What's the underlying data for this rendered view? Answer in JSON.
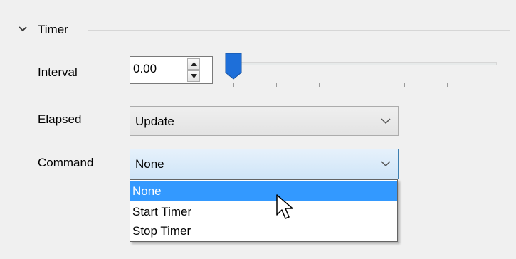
{
  "group": {
    "title": "Timer",
    "expanded": true
  },
  "interval": {
    "label": "Interval",
    "value": "0.00",
    "slider_fraction": 0.0
  },
  "elapsed": {
    "label": "Elapsed",
    "selected": "Update"
  },
  "command": {
    "label": "Command",
    "selected": "None",
    "options": [
      "None",
      "Start Timer",
      "Stop Timer"
    ],
    "highlighted_option": "None"
  },
  "icons": {
    "collapse": "chevron-down-icon",
    "spin_up": "triangle-up-icon",
    "spin_down": "triangle-down-icon",
    "dropdown": "chevron-down-icon",
    "cursor": "mouse-pointer-icon"
  },
  "colors": {
    "accent": "#3399ff",
    "slider_thumb": "#1e6fd9",
    "active_combo_border": "#3c7fb1"
  }
}
